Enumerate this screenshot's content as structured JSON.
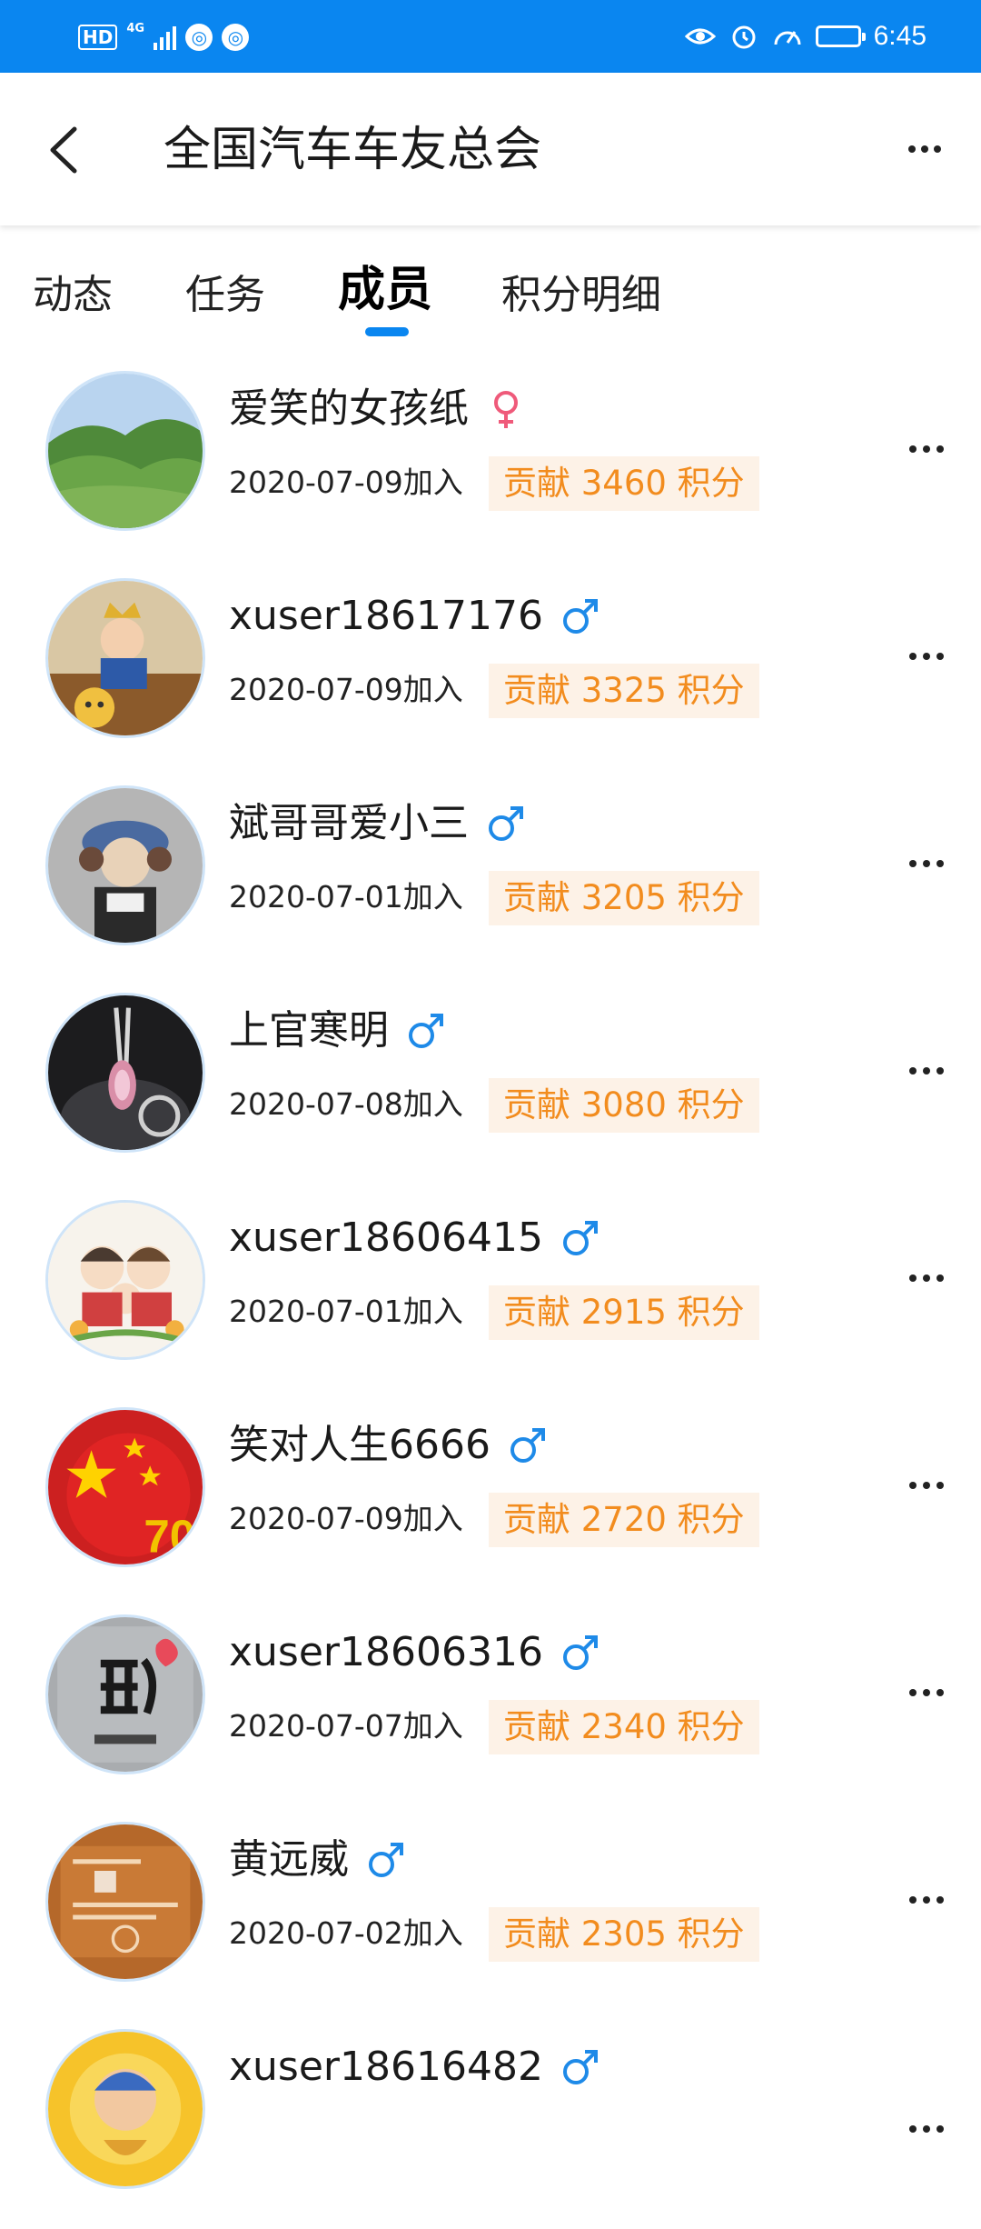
{
  "status_bar": {
    "network": "4G",
    "hd_label": "HD",
    "time": "6:45"
  },
  "header": {
    "title": "全国汽车车友总会",
    "back_icon": "back-arrow-icon",
    "more_icon": "more-horizontal-icon"
  },
  "tabs": [
    {
      "label": "动态",
      "active": false
    },
    {
      "label": "任务",
      "active": false
    },
    {
      "label": "成员",
      "active": true
    },
    {
      "label": "积分明细",
      "active": false
    }
  ],
  "colors": {
    "accent": "#0a86f0",
    "female": "#ef5a7a",
    "male": "#1e8ae8",
    "points_text": "#f28c1e",
    "points_bg": "#fdf2e7"
  },
  "members": [
    {
      "name": "爱笑的女孩纸",
      "gender": "female",
      "joined": "2020-07-09加入",
      "points": "贡献 3460 积分",
      "avatar": "mountain-landscape"
    },
    {
      "name": "xuser18617176",
      "gender": "male",
      "joined": "2020-07-09加入",
      "points": "贡献 3325 积分",
      "avatar": "child-with-crown"
    },
    {
      "name": "斌哥哥爱小三",
      "gender": "male",
      "joined": "2020-07-01加入",
      "points": "贡献 3205 积分",
      "avatar": "cartoon-character"
    },
    {
      "name": "上官寒明",
      "gender": "male",
      "joined": "2020-07-08加入",
      "points": "贡献 3080 积分",
      "avatar": "car-interior"
    },
    {
      "name": "xuser18606415",
      "gender": "male",
      "joined": "2020-07-01加入",
      "points": "贡献 2915 积分",
      "avatar": "cartoon-family"
    },
    {
      "name": "笑对人生6666",
      "gender": "male",
      "joined": "2020-07-09加入",
      "points": "贡献 2720 积分",
      "avatar": "red-flag-70"
    },
    {
      "name": "xuser18606316",
      "gender": "male",
      "joined": "2020-07-07加入",
      "points": "贡献 2340 积分",
      "avatar": "calligraphy-character"
    },
    {
      "name": "黄远威",
      "gender": "male",
      "joined": "2020-07-02加入",
      "points": "贡献 2305 积分",
      "avatar": "business-card"
    },
    {
      "name": "xuser18616482",
      "gender": "male",
      "joined": "",
      "points": "",
      "avatar": "buddha-figure"
    }
  ]
}
